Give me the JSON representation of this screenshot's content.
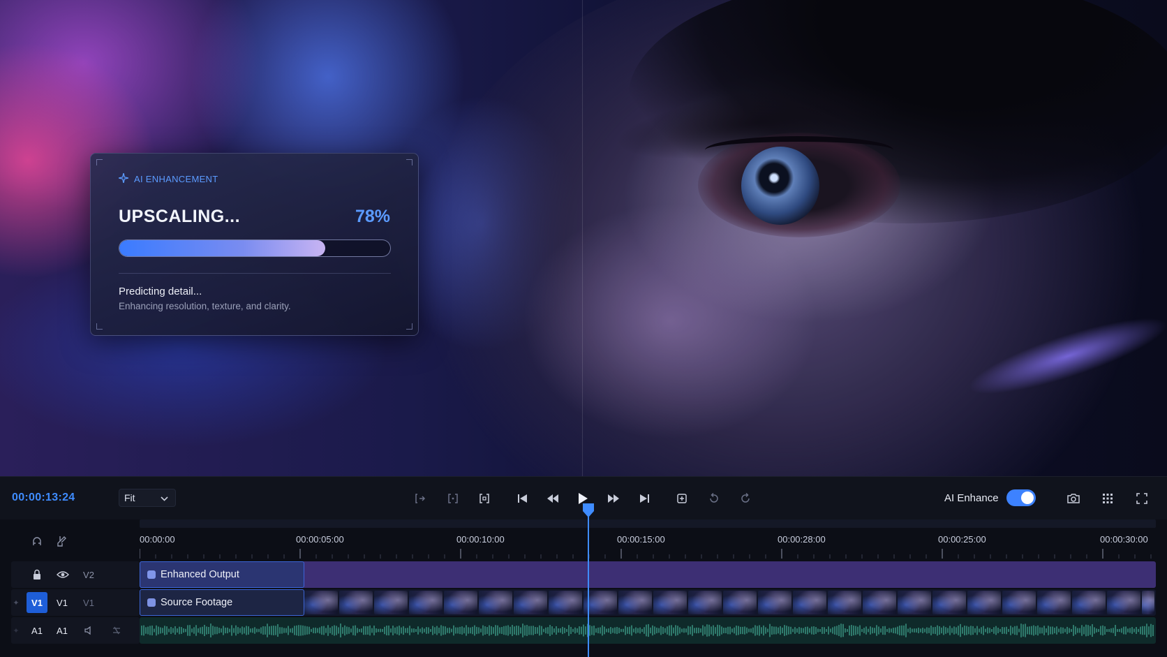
{
  "ai_panel": {
    "header": "AI ENHANCEMENT",
    "header_icon": "sparkle-icon",
    "title": "UPSCALING...",
    "percent_label": "78%",
    "progress": 0.76,
    "status": "Predicting detail...",
    "substatus": "Enhancing resolution, texture, and clarity.",
    "accent_color": "#5b9bff"
  },
  "transport": {
    "timecode": "00:00:13:24",
    "zoom_select": "Fit",
    "ai_enhance_label": "AI Enhance",
    "ai_enhance_on": true,
    "icons": [
      "mark-in-icon",
      "mark-clip-icon",
      "match-frame-icon",
      "go-to-start-icon",
      "step-back-icon",
      "play-icon",
      "step-forward-icon",
      "go-to-end-icon",
      "insert-icon",
      "undo-icon",
      "redo-icon",
      "snapshot-icon",
      "grid-icon",
      "fullscreen-icon"
    ]
  },
  "timeline": {
    "tick_labels": [
      "00:00:00",
      "00:00:05:00",
      "00:00:10:00",
      "00:00:15:00",
      "00:00:28:00",
      "00:00:25:00",
      "00:00:30:00"
    ],
    "playhead_time": "00:00:13:24",
    "tracks": [
      {
        "id": "V2",
        "clip": "Enhanced Output"
      },
      {
        "id": "V1",
        "source": "V1",
        "alt": "V1",
        "clip": "Source Footage"
      },
      {
        "id": "A1",
        "source": "A1"
      }
    ]
  },
  "colors": {
    "accent": "#3f8cff",
    "enhanced_clip": "#3d2f74",
    "audio_wave": "#2f7a6c"
  }
}
